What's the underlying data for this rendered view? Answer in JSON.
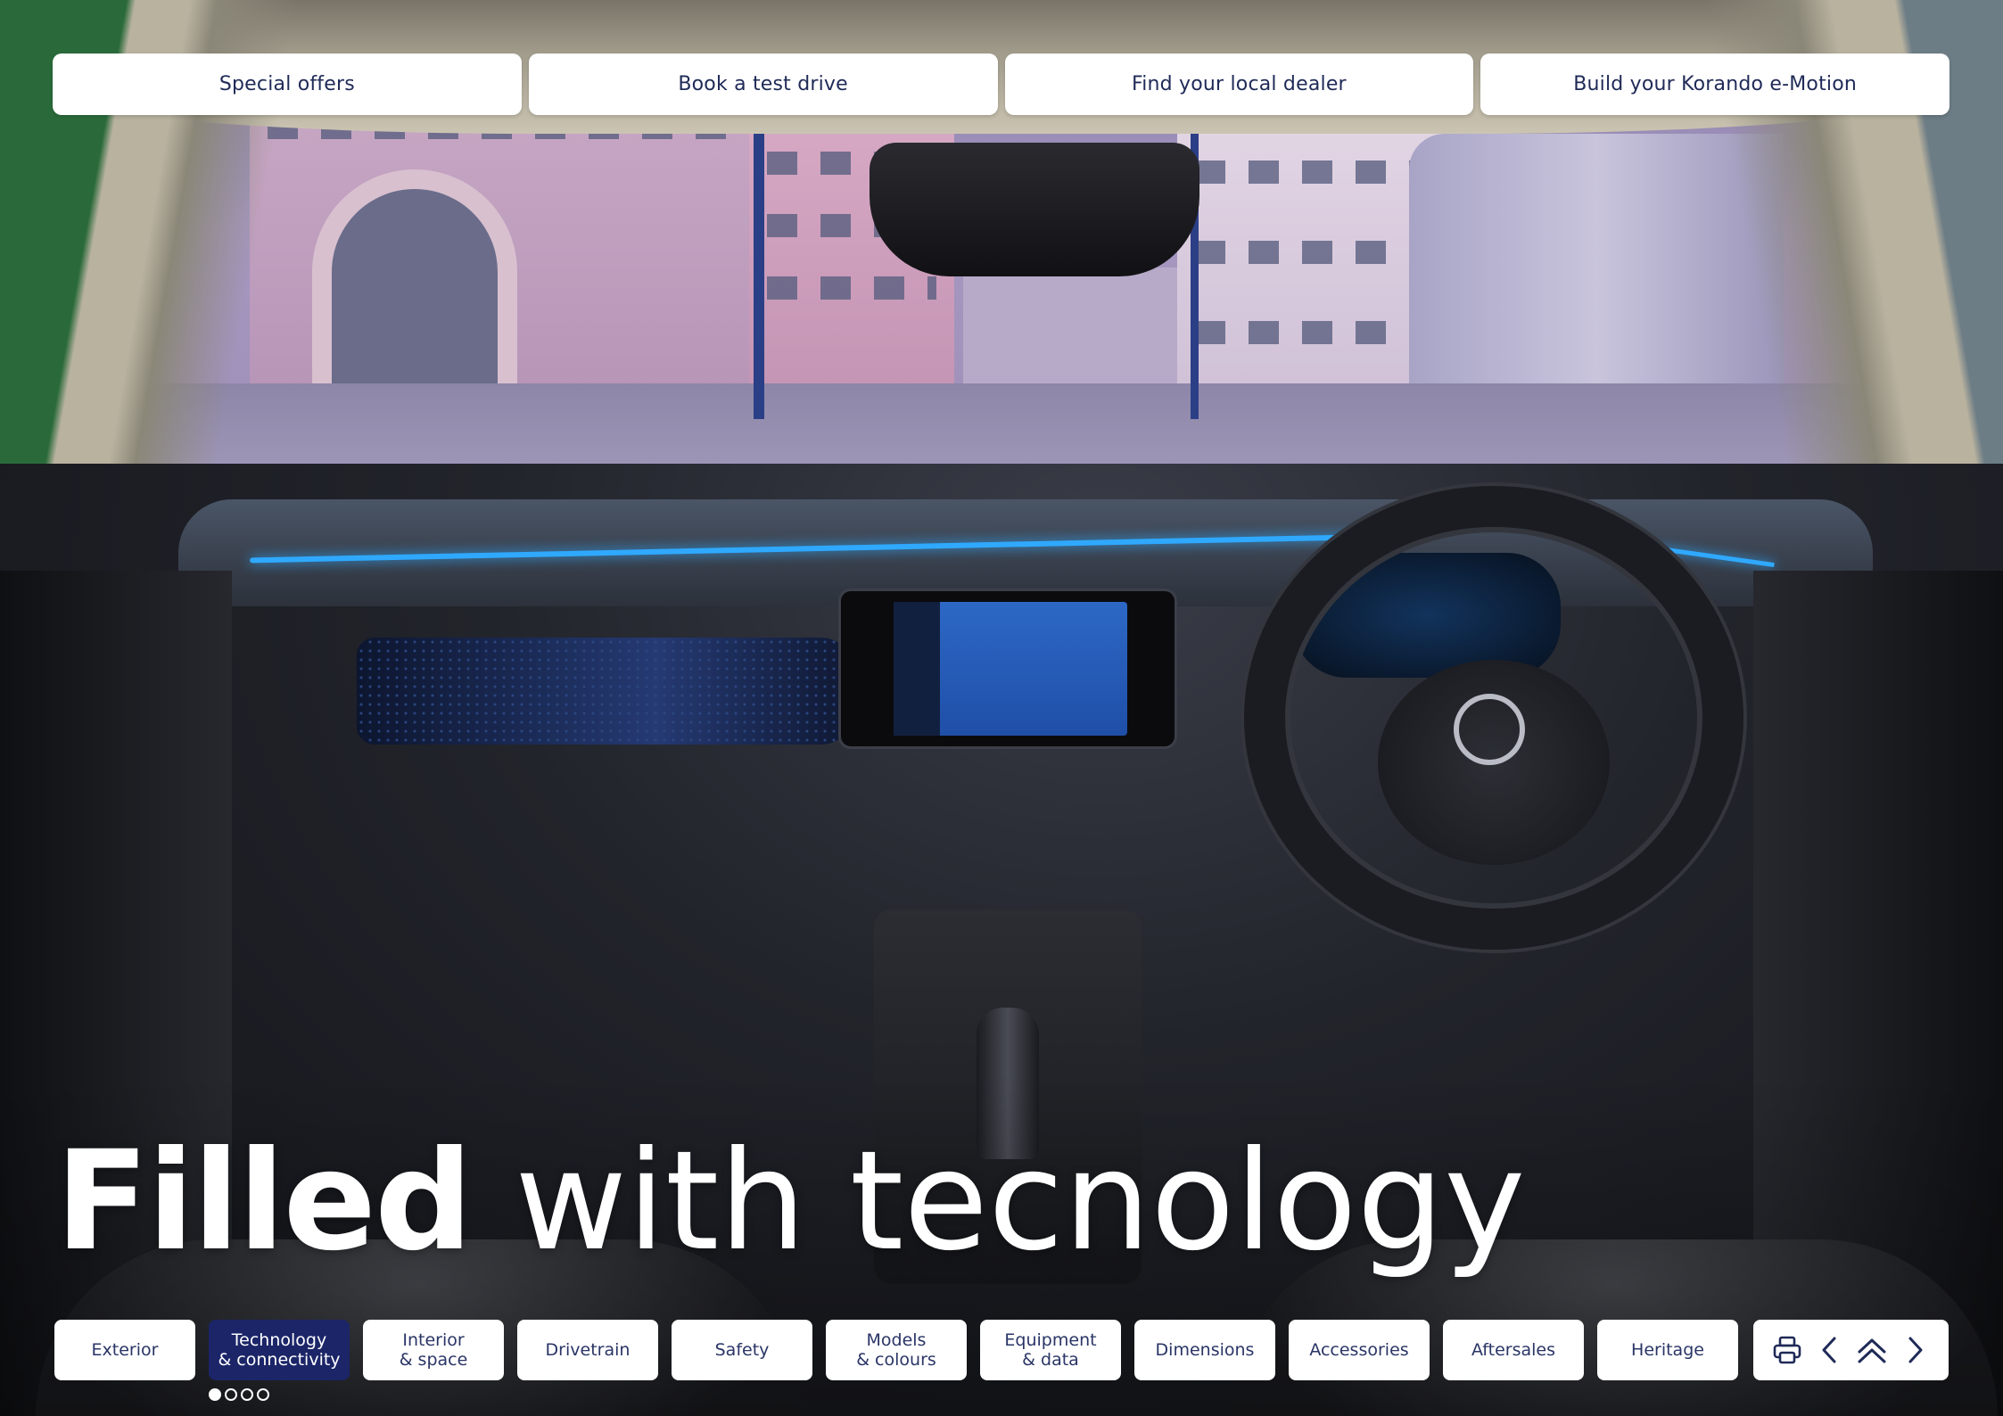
{
  "top_buttons": [
    {
      "label": "Special offers"
    },
    {
      "label": "Book a test drive"
    },
    {
      "label": "Find your local dealer"
    },
    {
      "label": "Build your Korando e-Motion"
    }
  ],
  "headline": {
    "bold": "Filled",
    "light": " with tecnology"
  },
  "nav": {
    "items": [
      {
        "label": "Exterior",
        "active": false
      },
      {
        "label": "Technology\n& connectivity",
        "active": true
      },
      {
        "label": "Interior\n& space",
        "active": false
      },
      {
        "label": "Drivetrain",
        "active": false
      },
      {
        "label": "Safety",
        "active": false
      },
      {
        "label": "Models\n& colours",
        "active": false
      },
      {
        "label": "Equipment\n& data",
        "active": false
      },
      {
        "label": "Dimensions",
        "active": false
      },
      {
        "label": "Accessories",
        "active": false
      },
      {
        "label": "Aftersales",
        "active": false
      },
      {
        "label": "Heritage",
        "active": false
      }
    ],
    "active_color": "#1b2568"
  },
  "tools": {
    "icons": [
      "print-icon",
      "chevron-left-icon",
      "double-chevron-up-icon",
      "chevron-right-icon"
    ]
  },
  "pagination": {
    "total": 4,
    "current": 1
  },
  "colors": {
    "brand_navy": "#1b2568",
    "text_navy": "#1f2a57",
    "button_bg": "#ffffff"
  }
}
